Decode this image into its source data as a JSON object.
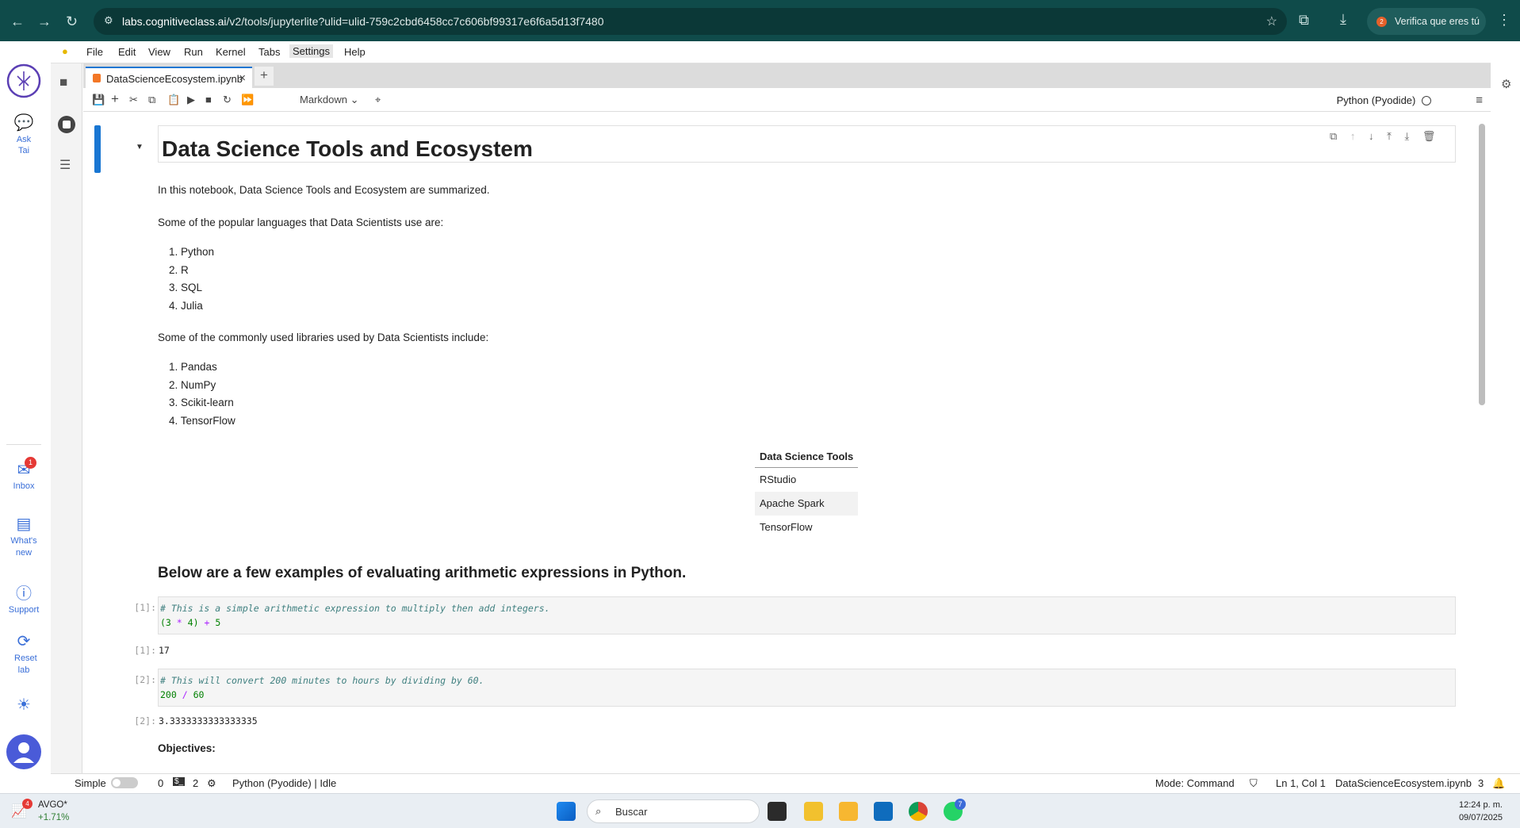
{
  "browser": {
    "url_host": "labs.cognitiveclass.ai",
    "url_path": "/v2/tools/jupyterlite?ulid=ulid-759c2cbd6458cc7c606bf99317e6f6a5d13f7480",
    "profile_badge": "2",
    "profile_label": "Verifica que eres tú"
  },
  "menu": [
    "File",
    "Edit",
    "View",
    "Run",
    "Kernel",
    "Tabs",
    "Settings",
    "Help"
  ],
  "platform_sidebar": {
    "ask": "Ask Tai",
    "inbox": "Inbox",
    "inbox_badge": "1",
    "whats_new": "What's new",
    "support": "Support",
    "reset": "Reset lab"
  },
  "tab": {
    "filename": "DataScienceEcosystem.ipynb"
  },
  "toolbar": {
    "cell_type": "Markdown",
    "kernel": "Python (Pyodide)"
  },
  "notebook": {
    "title": "Data Science Tools and Ecosystem",
    "intro": "In this notebook, Data Science Tools and Ecosystem are summarized.",
    "languages_intro": "Some of the popular languages that Data Scientists use are:",
    "languages": [
      "1. Python",
      "2. R",
      "3. SQL",
      "4. Julia"
    ],
    "libraries_intro": "Some of the commonly used libraries used by Data Scientists include:",
    "libraries": [
      "1. Pandas",
      "2. NumPy",
      "3. Scikit-learn",
      "4. TensorFlow"
    ],
    "tools_table": {
      "header": "Data Science Tools",
      "rows": [
        "RStudio",
        "Apache Spark",
        "TensorFlow"
      ]
    },
    "arith_heading": "Below are a few examples of evaluating arithmetic expressions in Python.",
    "cell1": {
      "prompt": "[1]:",
      "comment": "# This is a simple arithmetic expression to multiply then add integers.",
      "code": [
        "(3",
        "*",
        "4)",
        "+",
        "5"
      ],
      "output": "17"
    },
    "cell2": {
      "prompt": "[2]:",
      "comment": "# This will convert 200 minutes to hours by dividing by 60.",
      "code": [
        "200",
        "/",
        "60"
      ],
      "output": "3.3333333333333335"
    },
    "objectives": "Objectives:"
  },
  "statusbar": {
    "mode_label": "Simple",
    "num0": "0",
    "num2": "2",
    "kernel_status": "Python (Pyodide) | Idle",
    "mode": "Mode: Command",
    "position": "Ln 1, Col 1",
    "filename": "DataScienceEcosystem.ipynb",
    "count": "3"
  },
  "taskbar": {
    "stock_name": "AVGO*",
    "stock_change": "+1.71%",
    "stock_badge": "4",
    "search_placeholder": "Buscar",
    "whatsapp_badge": "7",
    "time": "12:24 p. m.",
    "date": "09/07/2025"
  }
}
